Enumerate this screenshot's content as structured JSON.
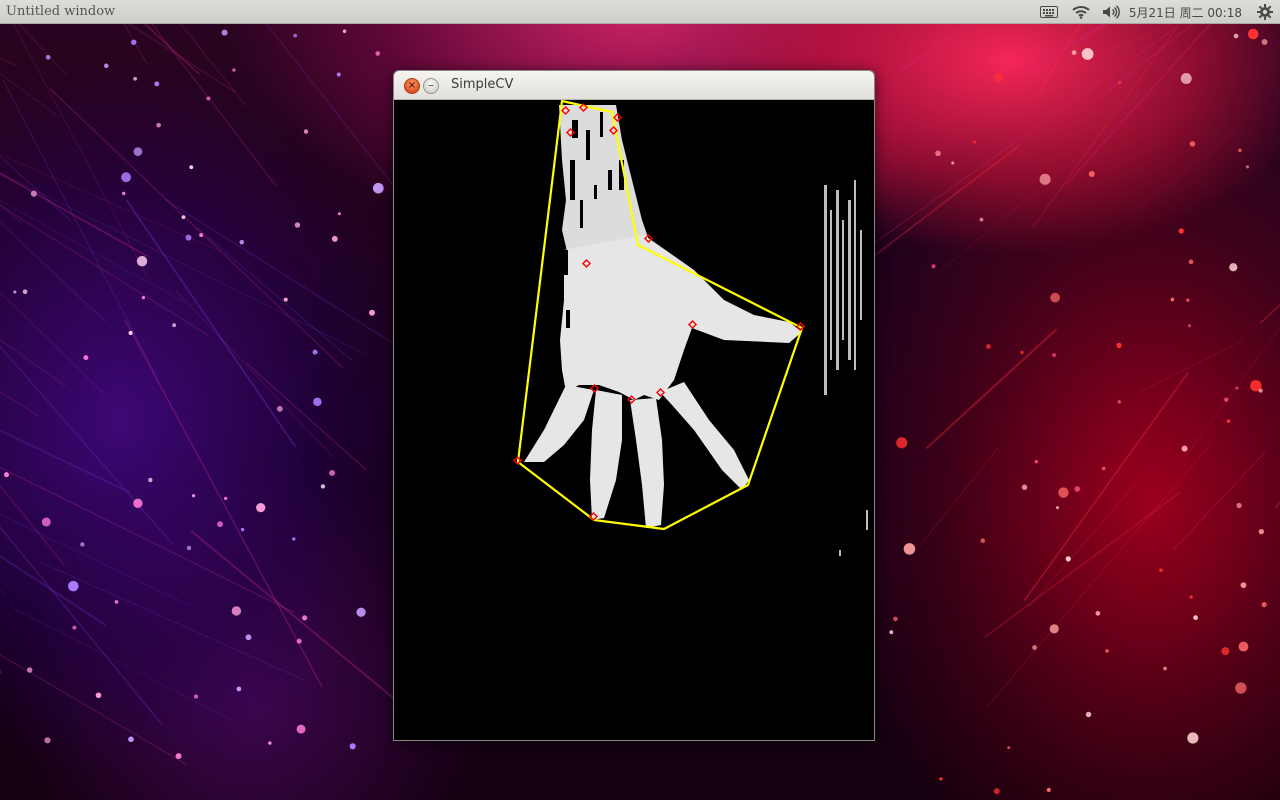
{
  "panel": {
    "window_title": "Untitled window",
    "indicators": [
      "keyboard-icon",
      "wifi-icon",
      "volume-icon"
    ],
    "clock": "5月21日 周二 00:18",
    "settings_icon": "gear-icon"
  },
  "window": {
    "title": "SimpleCV",
    "close_label": "×",
    "minimize_label": "–"
  },
  "canvas": {
    "background": "#000000",
    "hand_color": "#e6e6e6",
    "hull_color": "#ffff00",
    "defect_marker_color": "#ff0000"
  }
}
